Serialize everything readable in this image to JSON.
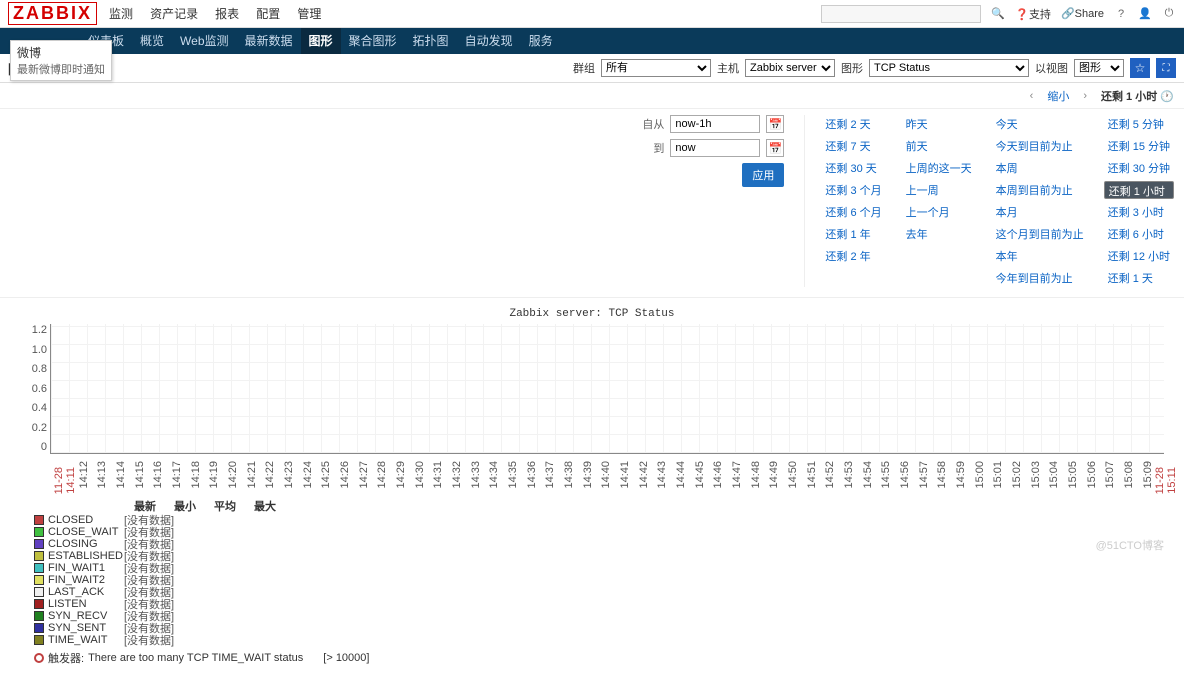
{
  "logo": "ZABBIX",
  "topnav": [
    "监测",
    "资产记录",
    "报表",
    "配置",
    "管理"
  ],
  "topright": {
    "support": "支持",
    "share": "Share"
  },
  "subnav": {
    "items": [
      "仪表板",
      "概览",
      "Web监测",
      "最新数据",
      "图形",
      "聚合图形",
      "拓扑图",
      "自动发现",
      "服务"
    ],
    "active": 4
  },
  "tooltip": {
    "line1": "微博",
    "line2": "最新微博即时通知"
  },
  "filter": {
    "title": "图形",
    "group_lbl": "群组",
    "group_val": "所有",
    "host_lbl": "主机",
    "host_val": "Zabbix server",
    "graph_lbl": "图形",
    "graph_val": "TCP Status",
    "view_lbl": "以视图",
    "view_val": "图形"
  },
  "timebar": {
    "prev": "‹",
    "zoomout": "缩小",
    "next": "›",
    "current": "还剩 1 小时"
  },
  "custom": {
    "from_lbl": "自从",
    "from_val": "now-1h",
    "to_lbl": "到",
    "to_val": "now",
    "apply": "应用"
  },
  "quick": [
    [
      "还剩 2 天",
      "昨天",
      "今天",
      "还剩 5 分钟"
    ],
    [
      "还剩 7 天",
      "前天",
      "今天到目前为止",
      "还剩 15 分钟"
    ],
    [
      "还剩 30 天",
      "上周的这一天",
      "本周",
      "还剩 30 分钟"
    ],
    [
      "还剩 3 个月",
      "上一周",
      "本周到目前为止",
      "还剩 1 小时"
    ],
    [
      "还剩 6 个月",
      "上一个月",
      "本月",
      "还剩 3 小时"
    ],
    [
      "还剩 1 年",
      "去年",
      "这个月到目前为止",
      "还剩 6 小时"
    ],
    [
      "还剩 2 年",
      "",
      "本年",
      "还剩 12 小时"
    ],
    [
      "",
      "",
      "今年到目前为止",
      "还剩 1 天"
    ]
  ],
  "chart_data": {
    "type": "line",
    "title": "Zabbix server: TCP Status",
    "ylim": [
      0,
      1.2
    ],
    "yticks": [
      "1.2",
      "1.0",
      "0.8",
      "0.6",
      "0.4",
      "0.2",
      "0"
    ],
    "x_start": "11-28 14:11",
    "x_end": "11-28 15:11",
    "xticks": [
      "14:12",
      "14:13",
      "14:14",
      "14:15",
      "14:16",
      "14:17",
      "14:18",
      "14:19",
      "14:20",
      "14:21",
      "14:22",
      "14:23",
      "14:24",
      "14:25",
      "14:26",
      "14:27",
      "14:28",
      "14:29",
      "14:30",
      "14:31",
      "14:32",
      "14:33",
      "14:34",
      "14:35",
      "14:36",
      "14:37",
      "14:38",
      "14:39",
      "14:40",
      "14:41",
      "14:42",
      "14:43",
      "14:44",
      "14:45",
      "14:46",
      "14:47",
      "14:48",
      "14:49",
      "14:50",
      "14:51",
      "14:52",
      "14:53",
      "14:54",
      "14:55",
      "14:56",
      "14:57",
      "14:58",
      "14:59",
      "15:00",
      "15:01",
      "15:02",
      "15:03",
      "15:04",
      "15:05",
      "15:06",
      "15:07",
      "15:08",
      "15:09"
    ],
    "series": [
      {
        "name": "CLOSED",
        "color": "#c04040",
        "value": "[没有数据]"
      },
      {
        "name": "CLOSE_WAIT",
        "color": "#40c040",
        "value": "[没有数据]"
      },
      {
        "name": "CLOSING",
        "color": "#6040c0",
        "value": "[没有数据]"
      },
      {
        "name": "ESTABLISHED",
        "color": "#c0c040",
        "value": "[没有数据]"
      },
      {
        "name": "FIN_WAIT1",
        "color": "#40c0c0",
        "value": "[没有数据]"
      },
      {
        "name": "FIN_WAIT2",
        "color": "#e0e060",
        "value": "[没有数据]"
      },
      {
        "name": "LAST_ACK",
        "color": "#f0f0f0",
        "value": "[没有数据]"
      },
      {
        "name": "LISTEN",
        "color": "#a02020",
        "value": "[没有数据]"
      },
      {
        "name": "SYN_RECV",
        "color": "#208020",
        "value": "[没有数据]"
      },
      {
        "name": "SYN_SENT",
        "color": "#3030a0",
        "value": "[没有数据]"
      },
      {
        "name": "TIME_WAIT",
        "color": "#808020",
        "value": "[没有数据]"
      }
    ],
    "legend_hdr": [
      "最新",
      "最小",
      "平均",
      "最大"
    ]
  },
  "trigger": {
    "label": "触发器:",
    "text": "There are too many TCP TIME_WAIT status",
    "threshold": "[> 10000]"
  },
  "watermark": "@51CTO博客"
}
